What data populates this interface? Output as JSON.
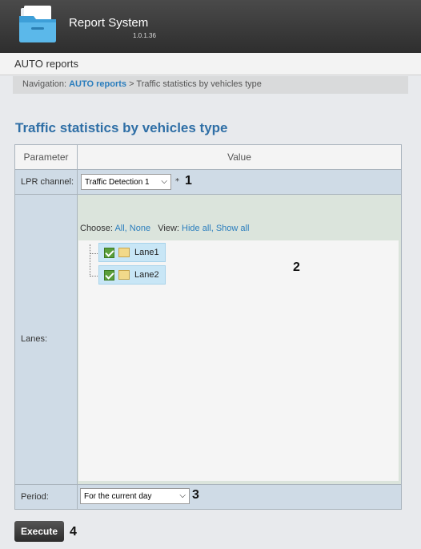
{
  "header": {
    "app_title": "Report System",
    "version": "1.0.1.36",
    "logo": "folder-logo-icon"
  },
  "subbar": {
    "title": "AUTO reports"
  },
  "breadcrumb": {
    "prefix": "Navigation:",
    "link": "AUTO reports",
    "separator": ">",
    "current": "Traffic statistics by vehicles type"
  },
  "page": {
    "title": "Traffic statistics by vehicles type"
  },
  "form": {
    "columns": [
      "Parameter",
      "Value"
    ],
    "lpr": {
      "label": "LPR channel:",
      "value": "Traffic Detection 1",
      "required_mark": "*",
      "callout": "1"
    },
    "lanes": {
      "label": "Lanes:",
      "choose_label": "Choose:",
      "choose_all": "All,",
      "choose_none": "None",
      "view_label": "View:",
      "hide_all": "Hide all,",
      "show_all": "Show all",
      "items": [
        {
          "label": "Lane1",
          "checked": true
        },
        {
          "label": "Lane2",
          "checked": true
        }
      ],
      "callout": "2"
    },
    "period": {
      "label": "Period:",
      "value": "For the current day",
      "callout": "3"
    }
  },
  "actions": {
    "execute_label": "Execute",
    "callout": "4"
  },
  "colors": {
    "header_bg": "#3a3a3a",
    "title_blue": "#2f6fa6",
    "link_blue": "#2a7dbd",
    "row_blue": "#cfdbe6",
    "row_green": "#dbe4dc"
  }
}
